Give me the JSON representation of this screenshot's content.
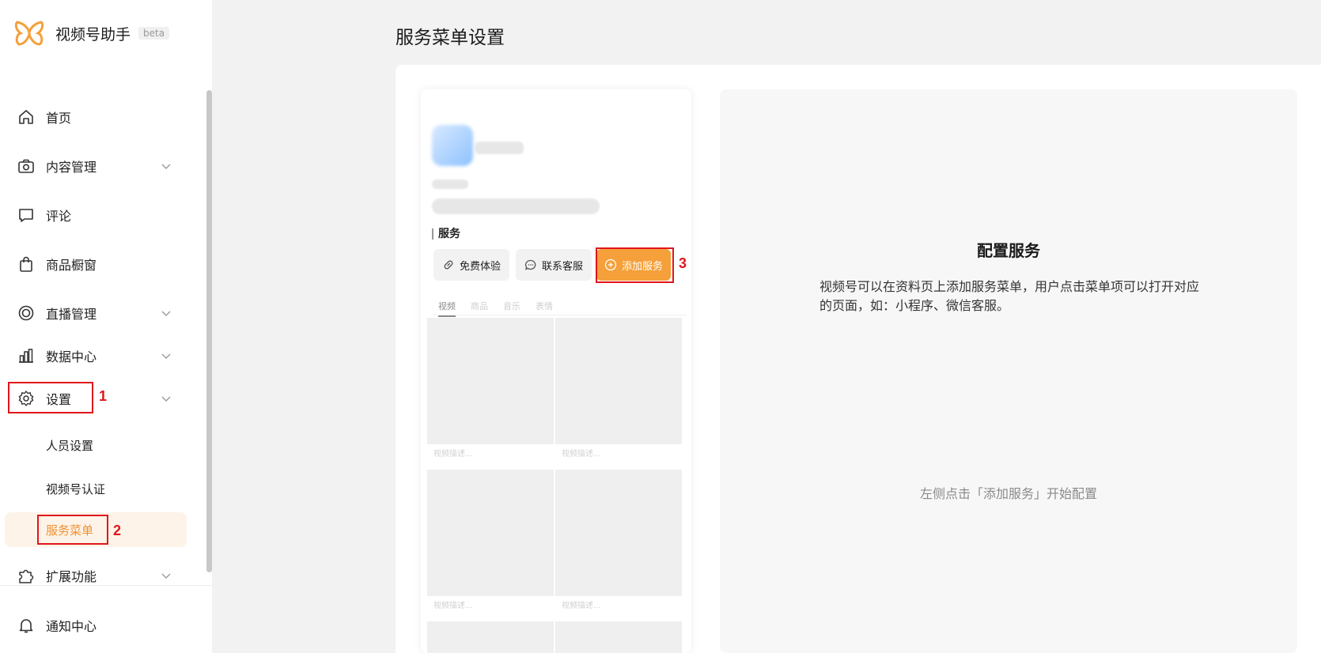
{
  "app": {
    "name": "视频号助手",
    "badge": "beta"
  },
  "sidebar": {
    "items": [
      {
        "label": "首页",
        "icon": "home-icon"
      },
      {
        "label": "内容管理",
        "icon": "camera-icon",
        "expandable": true
      },
      {
        "label": "评论",
        "icon": "comment-icon"
      },
      {
        "label": "商品橱窗",
        "icon": "shopping-bag-icon"
      },
      {
        "label": "直播管理",
        "icon": "live-icon",
        "expandable": true
      },
      {
        "label": "数据中心",
        "icon": "chart-icon",
        "expandable": true
      },
      {
        "label": "设置",
        "icon": "gear-icon",
        "expandable": true,
        "expanded": true
      },
      {
        "label": "扩展功能",
        "icon": "puzzle-icon",
        "expandable": true
      }
    ],
    "settings_sub": [
      {
        "label": "人员设置"
      },
      {
        "label": "视频号认证"
      },
      {
        "label": "服务菜单",
        "active": true
      }
    ],
    "bottom": {
      "label": "通知中心",
      "icon": "bell-icon"
    }
  },
  "annotations": [
    "1",
    "2",
    "3"
  ],
  "main": {
    "title": "服务菜单设置",
    "preview": {
      "section_label": "服务",
      "buttons": [
        {
          "label": "免费体验",
          "icon": "link-icon"
        },
        {
          "label": "联系客服",
          "icon": "chat-icon"
        },
        {
          "label": "添加服务",
          "icon": "plus-circle-icon"
        }
      ],
      "tabs": [
        "视频",
        "商品",
        "音乐",
        "表情"
      ],
      "tile_caption": "视频描述..."
    },
    "config": {
      "title": "配置服务",
      "description": "视频号可以在资料页上添加服务菜单，用户点击菜单项可以打开对应的页面，如：小程序、微信客服。",
      "hint": "左侧点击「添加服务」开始配置"
    }
  },
  "colors": {
    "accent": "#f0902f",
    "add_button": "#f5a03a",
    "annotation": "#e0161b",
    "active_bg": "#fdf3e8"
  }
}
